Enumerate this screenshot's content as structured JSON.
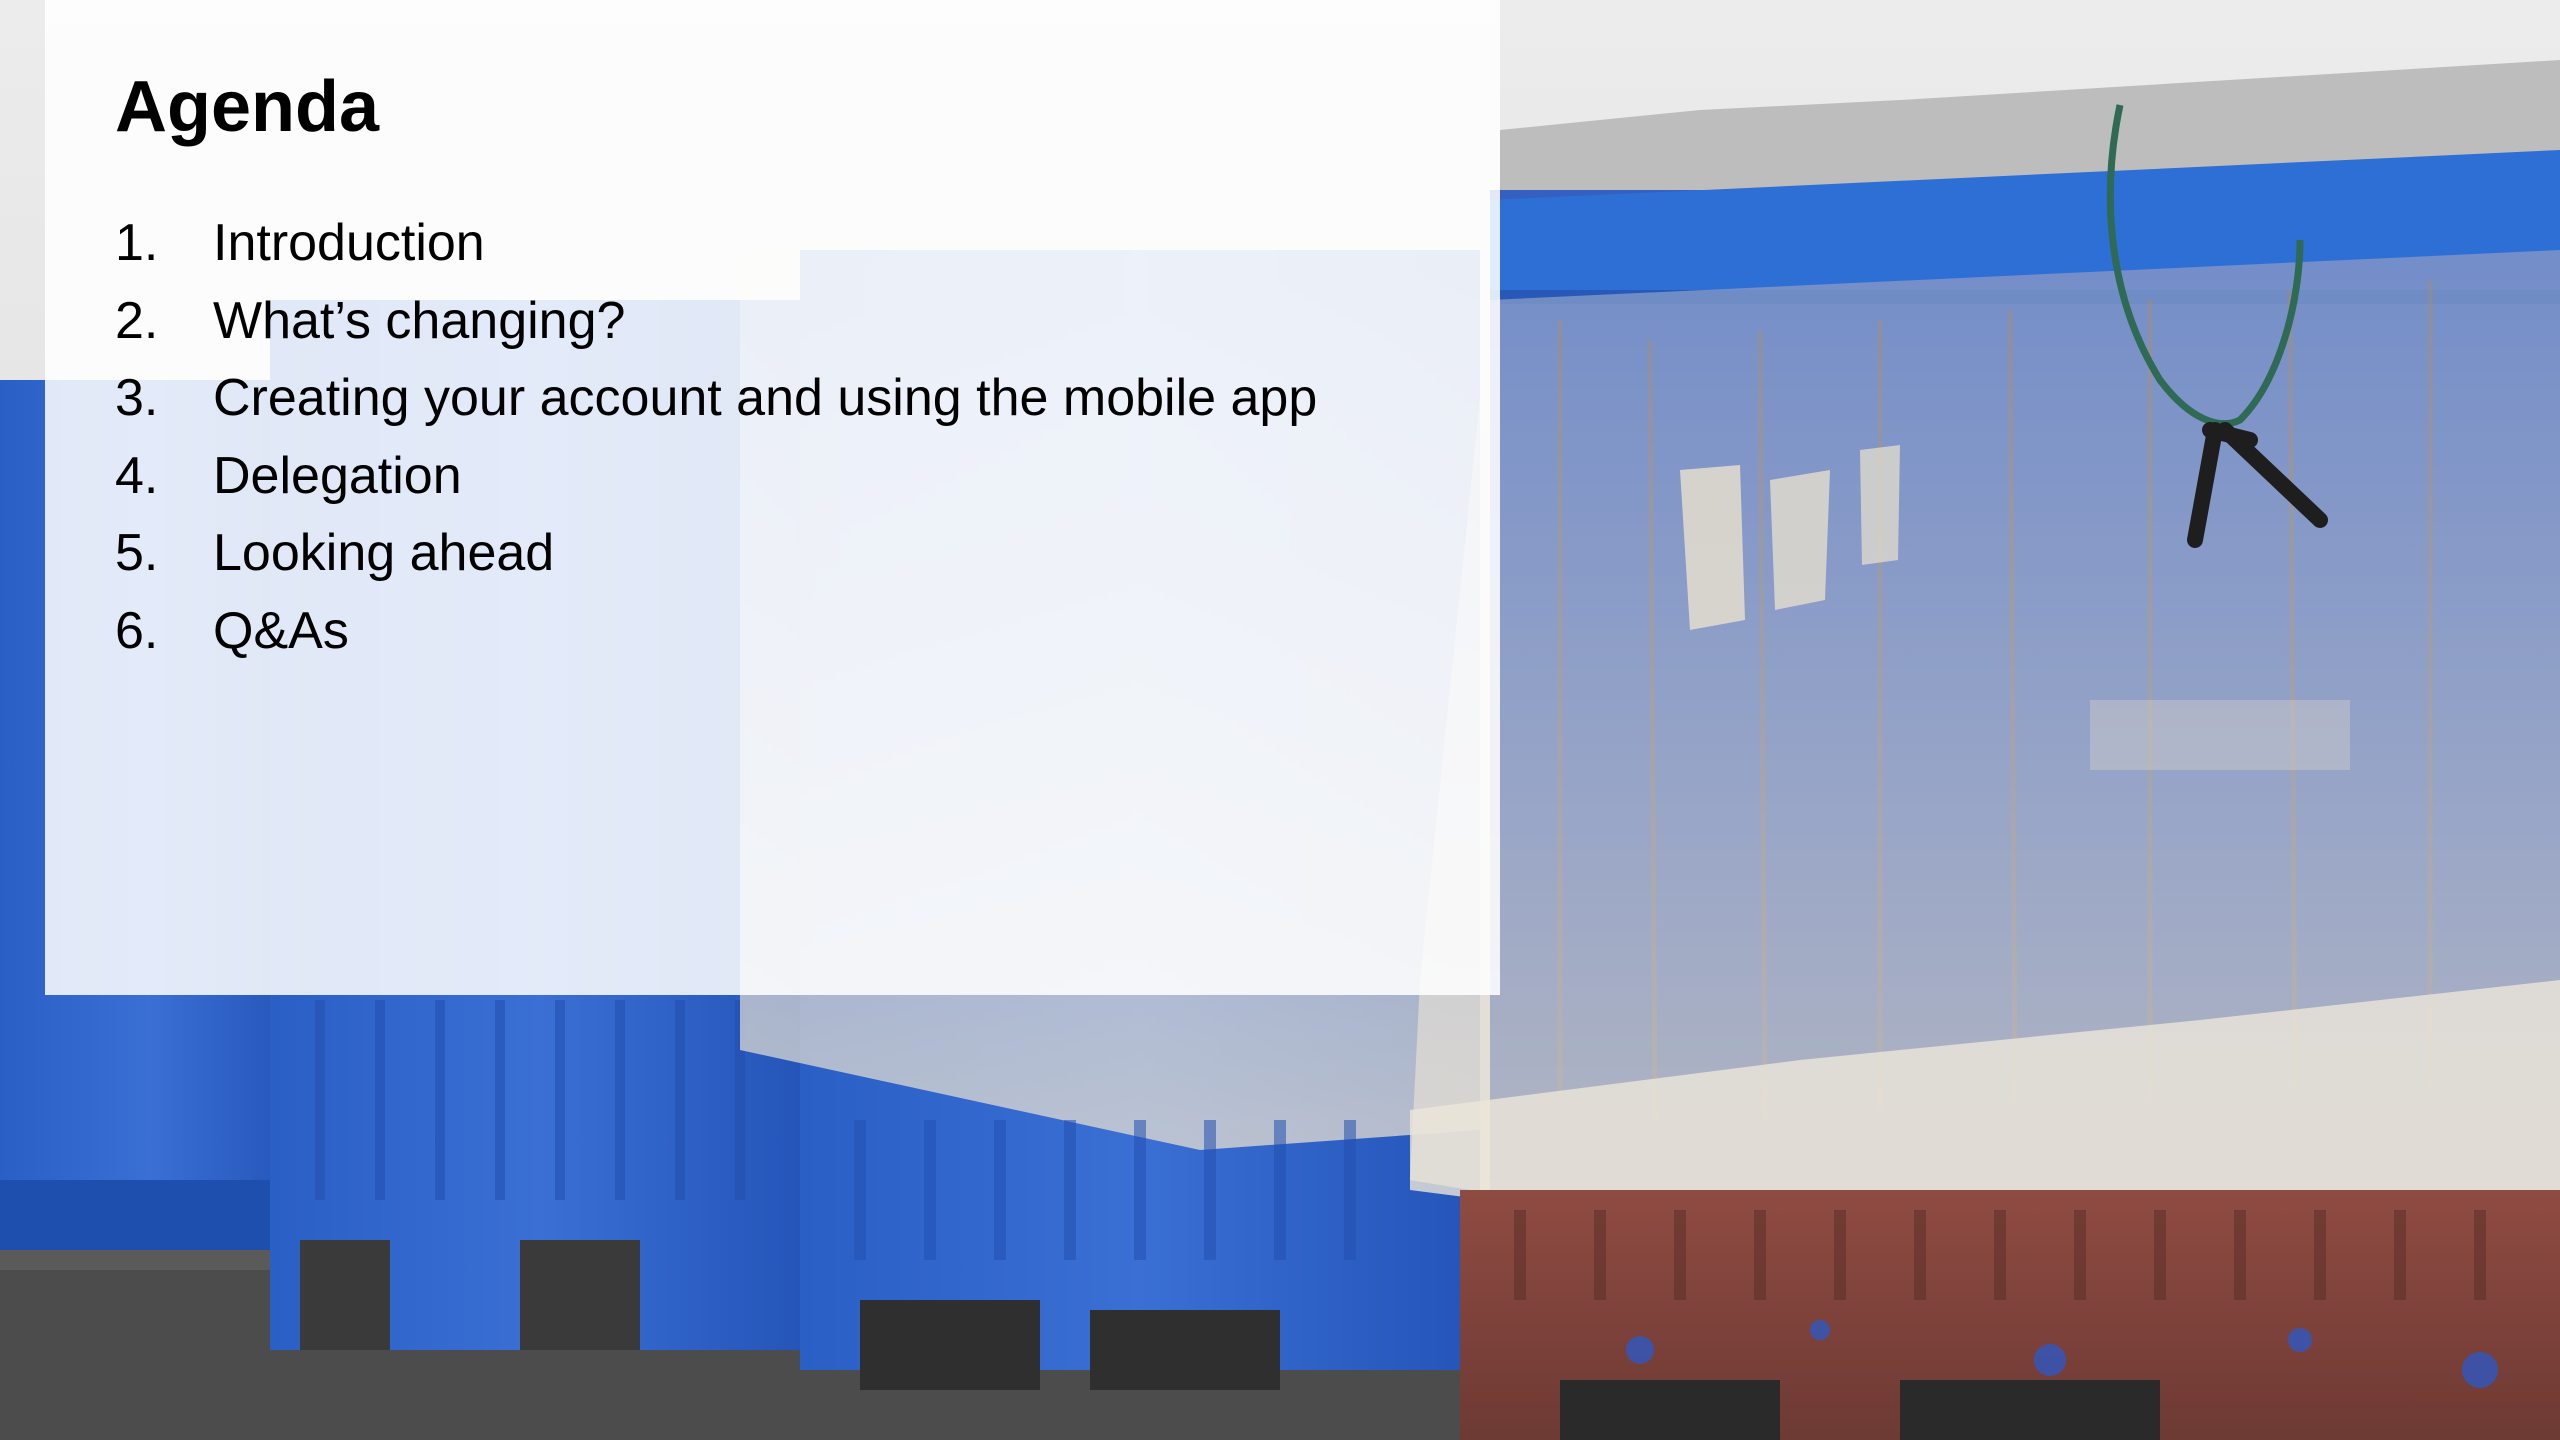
{
  "slide": {
    "title": "Agenda",
    "items": [
      {
        "number": "1.",
        "label": "Introduction"
      },
      {
        "number": "2.",
        "label": "What’s changing?"
      },
      {
        "number": "3.",
        "label": "Creating your account and using the mobile app"
      },
      {
        "number": "4.",
        "label": "Delegation"
      },
      {
        "number": "5.",
        "label": "Looking ahead"
      },
      {
        "number": "6.",
        "label": "Q&As"
      }
    ]
  },
  "colors": {
    "text": "#000000",
    "bin_blue": "#2f6fd0",
    "bin_blue_dark": "#1f4fb0",
    "bin_red": "#8a4a42",
    "ground": "#4e4e4e",
    "sky": "#e9e9e9"
  }
}
